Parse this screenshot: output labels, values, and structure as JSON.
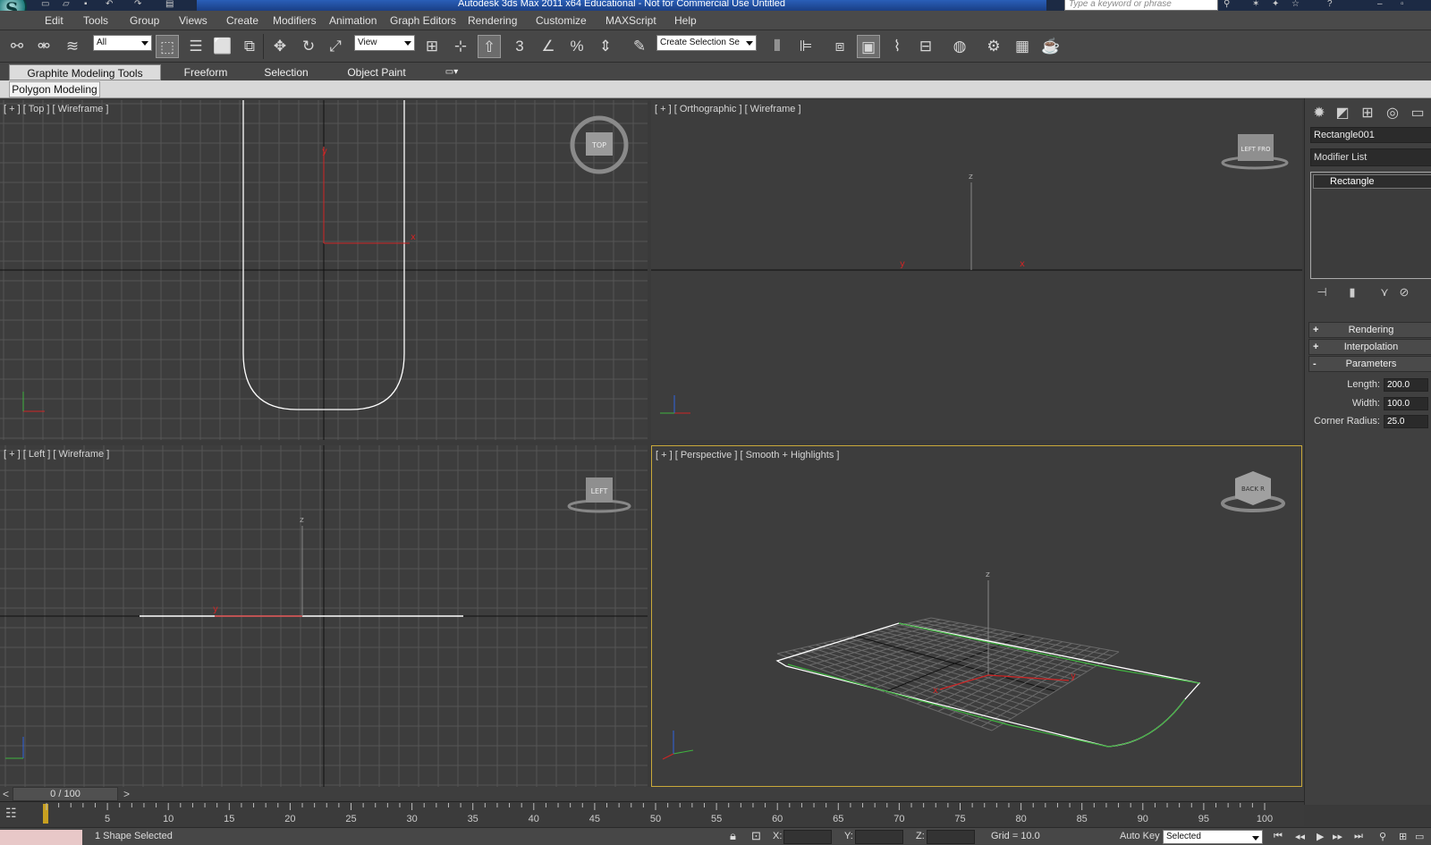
{
  "app": {
    "title": "Autodesk 3ds Max  2011 x64   Educational - Not for Commercial Use   Untitled",
    "logo_letter": "S",
    "search_placeholder": "Type a keyword or phrase"
  },
  "menu": [
    "Edit",
    "Tools",
    "Group",
    "Views",
    "Create",
    "Modifiers",
    "Animation",
    "Graph Editors",
    "Rendering",
    "Customize",
    "MAXScript",
    "Help"
  ],
  "toolbar": {
    "selection_filter": "All",
    "ref_coord": "View",
    "named_selection": "Create Selection Se",
    "snap_label": "3",
    "icons": [
      "link-icon",
      "unlink-icon",
      "bind-space-warp-icon",
      "select-object-icon",
      "select-by-name-icon",
      "rect-region-icon",
      "window-crossing-icon",
      "move-icon",
      "rotate-icon",
      "scale-icon",
      "pivot-icon",
      "manipulate-icon",
      "keyboard-shortcut-icon",
      "snap-icon",
      "angle-snap-icon",
      "percent-snap-icon",
      "spinner-snap-icon",
      "edit-named-selections-icon",
      "mirror-icon",
      "align-icon",
      "layer-manager-icon",
      "ribbon-toggle-icon",
      "curve-editor-icon",
      "schematic-view-icon",
      "material-editor-icon",
      "render-setup-icon",
      "rendered-frame-icon",
      "render-production-icon",
      "teapot-icon"
    ]
  },
  "ribbon": {
    "tabs": [
      "Graphite Modeling Tools",
      "Freeform",
      "Selection",
      "Object Paint"
    ],
    "panel": "Polygon Modeling"
  },
  "viewports": {
    "top": "[ + ] [ Top ] [ Wireframe ]",
    "ortho": "[ + ] [ Orthographic ] [ Wireframe ]",
    "left": "[ + ] [ Left ] [ Wireframe ]",
    "persp": "[ + ] [ Perspective ] [ Smooth + Highlights ]",
    "viewcube_top": "TOP",
    "viewcube_left": "LEFT",
    "viewcube_ortho": "LEFT  FRO",
    "viewcube_persp": "BACK  R",
    "axis_x": "x",
    "axis_y": "y",
    "axis_z": "z"
  },
  "command_panel": {
    "object_name": "Rectangle001",
    "modifier_list": "Modifier List",
    "stack_item": "Rectangle",
    "rollouts": {
      "rendering": "Rendering",
      "interpolation": "Interpolation",
      "parameters": "Parameters",
      "plus": "+",
      "minus": "-"
    },
    "params": {
      "length_label": "Length:",
      "length_value": "200.0",
      "width_label": "Width:",
      "width_value": "100.0",
      "corner_label": "Corner Radius:",
      "corner_value": "25.0"
    }
  },
  "timeline": {
    "frame_display": "0 / 100",
    "prev": "<",
    "next": ">",
    "ticks": [
      "5",
      "10",
      "15",
      "20",
      "25",
      "30",
      "35",
      "40",
      "45",
      "50",
      "55",
      "60",
      "65",
      "70",
      "75",
      "80",
      "85",
      "90",
      "95",
      "100"
    ]
  },
  "status": {
    "selection_text": "1 Shape Selected",
    "x_label": "X:",
    "y_label": "Y:",
    "z_label": "Z:",
    "grid": "Grid = 10.0",
    "auto_key": "Auto Key",
    "key_filter": "Selected"
  },
  "colors": {
    "viewport_bg": "#3d3d3d",
    "grid": "#555555",
    "active_border": "#c9a93a",
    "spline_white": "#ffffff",
    "spline_green": "#3fb33f",
    "axis_red": "#d02525"
  }
}
